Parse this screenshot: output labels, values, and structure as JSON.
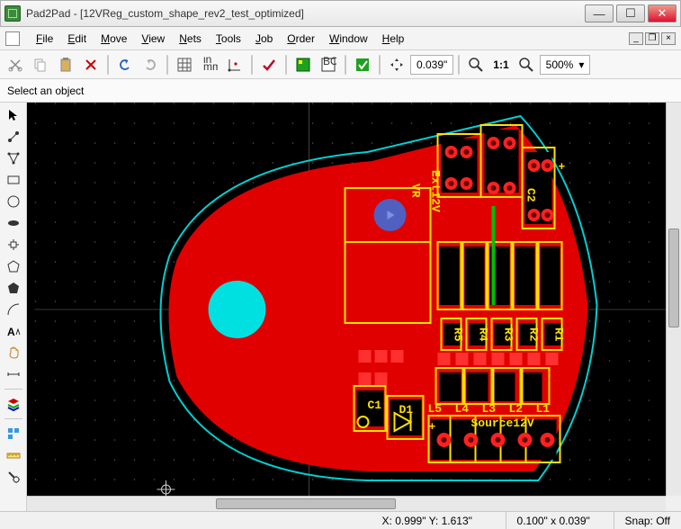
{
  "title": "Pad2Pad - [12VReg_custom_shape_rev2_test_optimized]",
  "menu": {
    "file": "File",
    "edit": "Edit",
    "move": "Move",
    "view": "View",
    "nets": "Nets",
    "tools": "Tools",
    "job": "Job",
    "order": "Order",
    "window": "Window",
    "help": "Help"
  },
  "toolbar": {
    "pitch": "0.039\"",
    "ratio": "1:1",
    "zoom": "500%"
  },
  "selection_prompt": "Select an object",
  "status": {
    "coords": "X: 0.999\" Y: 1.613\"",
    "grid": "0.100\" x 0.039\"",
    "snap": "Snap: Off"
  },
  "board_labels": {
    "vr": "VR",
    "ext12v": "Ext12V",
    "c2": "C2",
    "c1": "C1",
    "d1": "D1",
    "source12v": "Source12V",
    "r1": "R1",
    "r2": "R2",
    "r3": "R3",
    "r4": "R4",
    "r5": "R5",
    "l1": "L1",
    "l2": "L2",
    "l3": "L3",
    "l4": "L4",
    "l5": "L5",
    "plus1": "+",
    "plus2": "+"
  }
}
